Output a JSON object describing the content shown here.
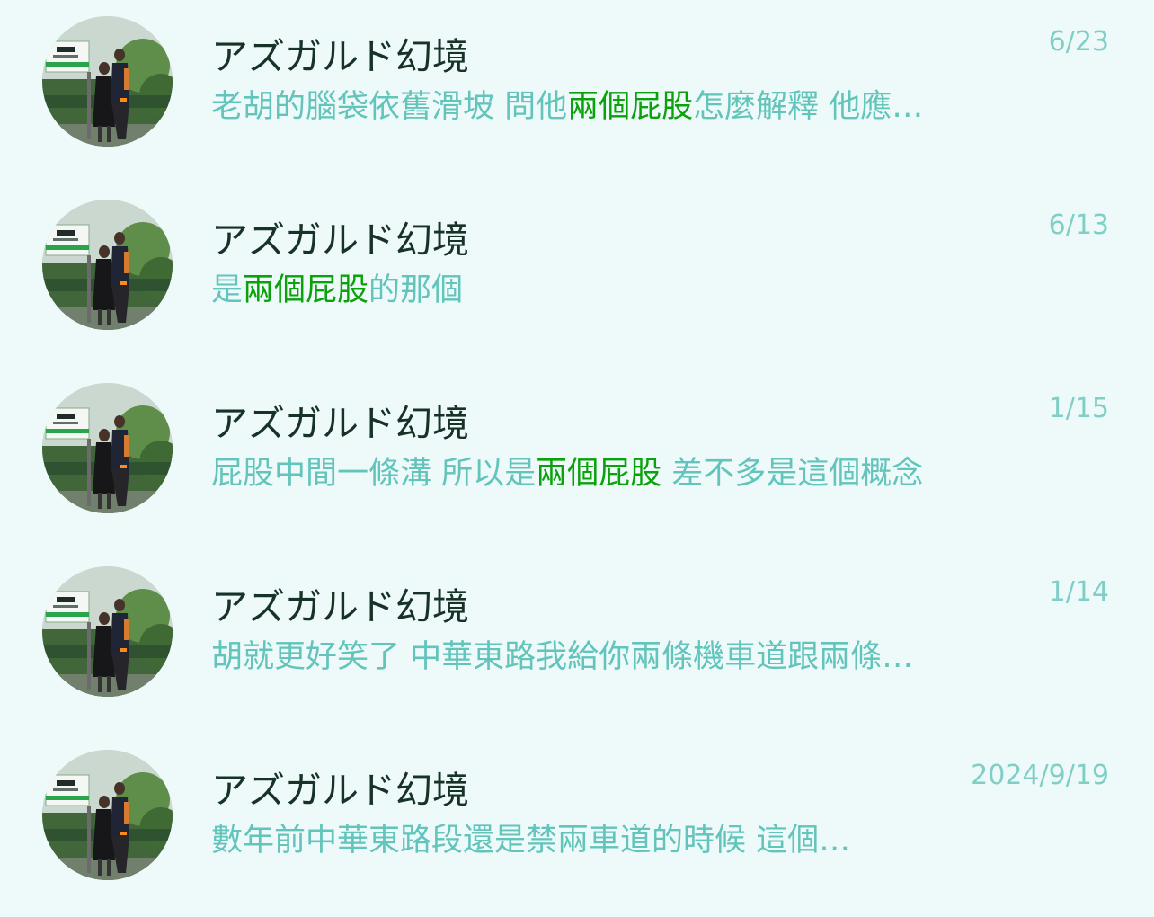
{
  "chats": [
    {
      "name": "アズガルド幻境",
      "date": "6/23",
      "message_parts": [
        "老胡的腦袋依舊滑坡 問他",
        "兩個屁股",
        "怎麼解釋 他應…"
      ]
    },
    {
      "name": "アズガルド幻境",
      "date": "6/13",
      "message_parts": [
        "是",
        "兩個屁股",
        "的那個"
      ]
    },
    {
      "name": "アズガルド幻境",
      "date": "1/15",
      "message_parts": [
        "屁股中間一條溝 所以是",
        "兩個屁股",
        " 差不多是這個概念"
      ]
    },
    {
      "name": "アズガルド幻境",
      "date": "1/14",
      "message_parts": [
        "胡就更好笑了 中華東路我給你兩條機車道跟兩條…",
        "",
        ""
      ]
    },
    {
      "name": "アズガルド幻境",
      "date": "2024/9/19",
      "message_parts": [
        "數年前中華東路段還是禁兩車道的時候 這個…",
        "",
        ""
      ]
    }
  ],
  "colors": {
    "background": "#eefafa",
    "name_text": "#173227",
    "message_text": "#62c4bb",
    "highlight_text": "#0ba10b",
    "date_text": "#7fcfc6"
  }
}
